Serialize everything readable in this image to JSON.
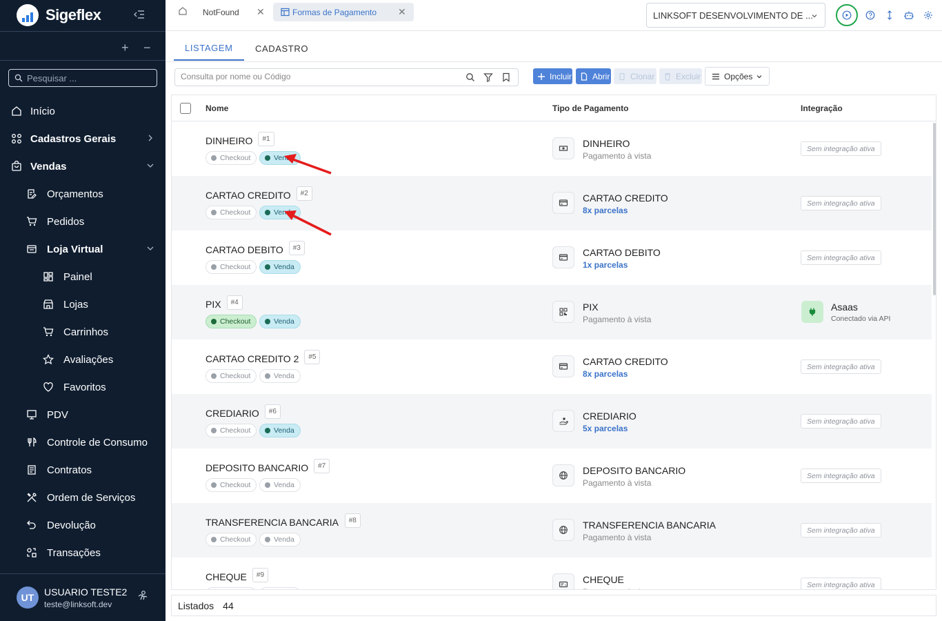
{
  "app": {
    "title": "Sigeflex"
  },
  "sidebar": {
    "search_placeholder": "Pesquisar ...",
    "items": [
      {
        "label": "Início",
        "icon": "home-icon"
      },
      {
        "label": "Cadastros Gerais",
        "icon": "grid-icon"
      },
      {
        "label": "Vendas",
        "icon": "bag-icon"
      },
      {
        "label": "Orçamentos",
        "icon": "edit-document-icon"
      },
      {
        "label": "Pedidos",
        "icon": "cart-icon"
      },
      {
        "label": "Loja Virtual",
        "icon": "store-icon"
      },
      {
        "label": "Painel",
        "icon": "dashboard-icon"
      },
      {
        "label": "Lojas",
        "icon": "shop-icon"
      },
      {
        "label": "Carrinhos",
        "icon": "cart-icon"
      },
      {
        "label": "Avaliações",
        "icon": "star-icon"
      },
      {
        "label": "Favoritos",
        "icon": "heart-icon"
      },
      {
        "label": "PDV",
        "icon": "monitor-icon"
      },
      {
        "label": "Controle de Consumo",
        "icon": "utensils-icon"
      },
      {
        "label": "Contratos",
        "icon": "document-icon"
      },
      {
        "label": "Ordem de Serviços",
        "icon": "tools-icon"
      },
      {
        "label": "Devolução",
        "icon": "undo-icon"
      },
      {
        "label": "Transações",
        "icon": "transactions-icon"
      }
    ]
  },
  "user": {
    "initials": "UT",
    "name": "USUARIO TESTE2",
    "email": "teste@linksoft.dev"
  },
  "tabs": [
    {
      "label": "NotFound"
    },
    {
      "label": "Formas de Pagamento"
    }
  ],
  "company": "LINKSOFT DESENVOLVIMENTO DE ...",
  "subtabs": [
    "LISTAGEM",
    "CADASTRO"
  ],
  "search": {
    "placeholder": "Consulta por nome ou Código"
  },
  "toolbar": {
    "incluir": "Incluir",
    "abrir": "Abrir",
    "clonar": "Clonar",
    "excluir": "Excluir",
    "opcoes": "Opções"
  },
  "table": {
    "headers": {
      "nome": "Nome",
      "tipo": "Tipo de Pagamento",
      "integracao": "Integração"
    },
    "checkout_label": "Checkout",
    "venda_label": "Venda",
    "no_integration": "Sem integração ativa",
    "rows": [
      {
        "name": "DINHEIRO",
        "num": "#1",
        "checkout": false,
        "venda": true,
        "type": "DINHEIRO",
        "sub": "Pagamento à vista",
        "parc": false,
        "icon": "cash-icon",
        "integ": null
      },
      {
        "name": "CARTAO CREDITO",
        "num": "#2",
        "checkout": false,
        "venda": true,
        "type": "CARTAO CREDITO",
        "sub": "8x parcelas",
        "parc": true,
        "icon": "credit-card-icon",
        "integ": null
      },
      {
        "name": "CARTAO DEBITO",
        "num": "#3",
        "checkout": false,
        "venda": true,
        "type": "CARTAO DEBITO",
        "sub": "1x parcelas",
        "parc": true,
        "icon": "credit-card-icon",
        "integ": null
      },
      {
        "name": "PIX",
        "num": "#4",
        "checkout": true,
        "venda": true,
        "type": "PIX",
        "sub": "Pagamento à vista",
        "parc": false,
        "icon": "qr-code-icon",
        "integ": {
          "name": "Asaas",
          "sub": "Conectado via API"
        }
      },
      {
        "name": "CARTAO CREDITO 2",
        "num": "#5",
        "checkout": false,
        "venda": false,
        "type": "CARTAO CREDITO",
        "sub": "8x parcelas",
        "parc": true,
        "icon": "credit-card-icon",
        "integ": null
      },
      {
        "name": "CREDIARIO",
        "num": "#6",
        "checkout": false,
        "venda": true,
        "type": "CREDIARIO",
        "sub": "5x parcelas",
        "parc": true,
        "icon": "hand-money-icon",
        "integ": null
      },
      {
        "name": "DEPOSITO BANCARIO",
        "num": "#7",
        "checkout": false,
        "venda": false,
        "type": "DEPOSITO BANCARIO",
        "sub": "Pagamento à vista",
        "parc": false,
        "icon": "globe-icon",
        "integ": null
      },
      {
        "name": "TRANSFERENCIA BANCARIA",
        "num": "#8",
        "checkout": false,
        "venda": false,
        "type": "TRANSFERENCIA BANCARIA",
        "sub": "Pagamento à vista",
        "parc": false,
        "icon": "globe-icon",
        "integ": null
      },
      {
        "name": "CHEQUE",
        "num": "#9",
        "checkout": false,
        "venda": false,
        "type": "CHEQUE",
        "sub": "Pagamento à vista",
        "parc": false,
        "icon": "cheque-icon",
        "integ": null
      }
    ]
  },
  "footer": {
    "label": "Listados",
    "count": "44"
  },
  "colors": {
    "sidebar_bg": "#0f1d2f",
    "accent": "#3b73c9",
    "primary_button": "#4f83d9",
    "annotation_arrow": "#e51c1c",
    "highlight_ring": "#1fa54b"
  }
}
